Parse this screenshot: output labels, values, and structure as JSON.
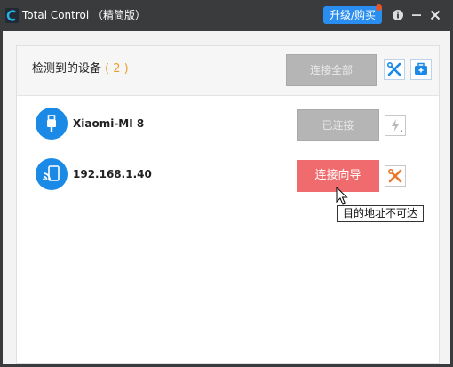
{
  "window": {
    "title": "Total Control （精简版）",
    "upgrade_label": "升级/购买"
  },
  "header": {
    "detected_label": "检测到的设备",
    "detected_count": "( 2 )",
    "connect_all_label": "连接全部"
  },
  "devices": [
    {
      "name": "Xiaomi-MI 8",
      "icon": "usb-icon",
      "action_label": "已连接"
    },
    {
      "name": "192.168.1.40",
      "icon": "wifi-icon",
      "action_label": "连接向导"
    }
  ],
  "tooltip": "目的地址不可达",
  "colors": {
    "titlebar": "#3a3b3d",
    "upgrade": "#2a8ef0",
    "count": "#e9a02c",
    "device_icon": "#1a8ae6",
    "wizard_button": "#f06b6d",
    "tool_orange": "#e8772a"
  }
}
